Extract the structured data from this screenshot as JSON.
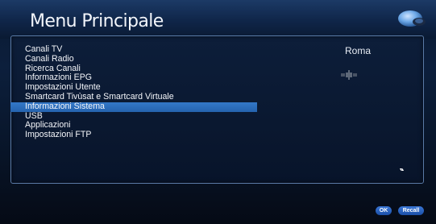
{
  "header": {
    "title": "Menu Principale"
  },
  "menu": {
    "items": [
      {
        "label": "Canali TV"
      },
      {
        "label": "Canali Radio"
      },
      {
        "label": "Ricerca Canali"
      },
      {
        "label": "Informazioni EPG"
      },
      {
        "label": "Impostazioni Utente"
      },
      {
        "label": "Smartcard Tivùsat e Smartcard Virtuale"
      },
      {
        "label": "Informazioni Sistema"
      },
      {
        "label": "USB"
      },
      {
        "label": "Applicazioni"
      },
      {
        "label": "Impostazioni FTP"
      }
    ],
    "selected_index": 6,
    "scroll_indicator": "▾▴"
  },
  "info": {
    "location": "Roma",
    "icon": "satellite-icon"
  },
  "footer": {
    "ok_label": "OK",
    "recall_label": "Recall"
  },
  "colors": {
    "background": "#0a1a33",
    "selection": "#2a6cb8",
    "panel_border": "#5a7aa6",
    "button": "#2a63c0"
  }
}
